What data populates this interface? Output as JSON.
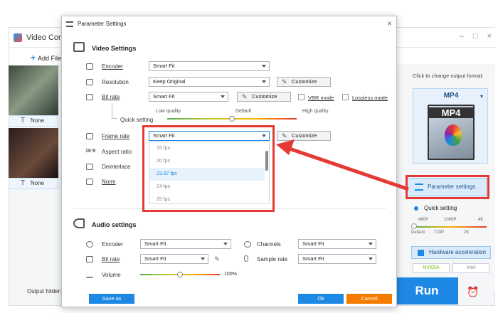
{
  "app": {
    "title": "Video Conv",
    "add_file_label": "Add File",
    "add_file_icon": "+",
    "window_controls": [
      "–",
      "□",
      "×"
    ],
    "tracks": [
      {
        "subtitle": "None",
        "icon_text": "T"
      },
      {
        "subtitle": "None",
        "icon_text": "T"
      }
    ],
    "output_folder_label": "Output folder:",
    "run_label": "Run",
    "alarm_icon": "⏰"
  },
  "right_panel": {
    "click_label": "Click to change output format:",
    "format_name": "MP4",
    "format_icon_text": "MP4",
    "parameter_settings_label": "Parameter settings",
    "quick_setting_label": "Quick setting",
    "quick_ticks_top": [
      "480P",
      "1080P",
      "4K"
    ],
    "quick_ticks_bottom": [
      "Default",
      "720P",
      "2K"
    ],
    "hardware_acceleration_label": "Hardware acceleration",
    "vendors": [
      "NVIDIA",
      "Intel"
    ]
  },
  "dialog": {
    "title": "Parameter Settings",
    "close_icon": "×",
    "video_settings_label": "Video Settings",
    "encoder_label": "Encoder",
    "encoder_value": "Smart Fit",
    "resolution_label": "Resolution",
    "resolution_value": "Keep Original",
    "resolution_customize": "Customize",
    "bitrate_label": "Bit rate",
    "bitrate_value": "Smart Fit",
    "bitrate_customize": "Customize",
    "vbr_label": "VBR mode",
    "lossless_label": "Lossless mode",
    "quick_setting_label": "Quick setting",
    "quality_low": "Low quality",
    "quality_default": "Default",
    "quality_high": "High quality",
    "framerate_label": "Frame rate",
    "framerate_value": "Smart Fit",
    "framerate_customize": "Customize",
    "framerate_options": [
      "15 fps",
      "20 fps",
      "23.97 fps",
      "24 fps",
      "25 fps"
    ],
    "framerate_selected_index": 2,
    "aspect_label": "Aspect ratio",
    "deinterlace_label": "Deinterlace",
    "norm_label": "Norm",
    "audio_settings_label": "Audio settings",
    "audio_encoder_label": "Encoder",
    "audio_encoder_value": "Smart Fit",
    "audio_bitrate_label": "Bit rate",
    "audio_bitrate_value": "Smart Fit",
    "channels_label": "Channels",
    "channels_value": "Smart Fit",
    "samplerate_label": "Sample rate",
    "samplerate_value": "Smart Fit",
    "volume_label": "Volume",
    "volume_value": "100%",
    "volume_level": 0.5,
    "quality_level": 0.5,
    "save_as_label": "Save as",
    "ok_label": "Ok",
    "cancel_label": "Cancel",
    "pen_icon": "✎"
  },
  "colors": {
    "accent": "#1e88e5",
    "highlight": "#e53935",
    "ok_button": "#1e88e5",
    "cancel_button": "#f57c00",
    "save_button": "#1e88e5"
  }
}
